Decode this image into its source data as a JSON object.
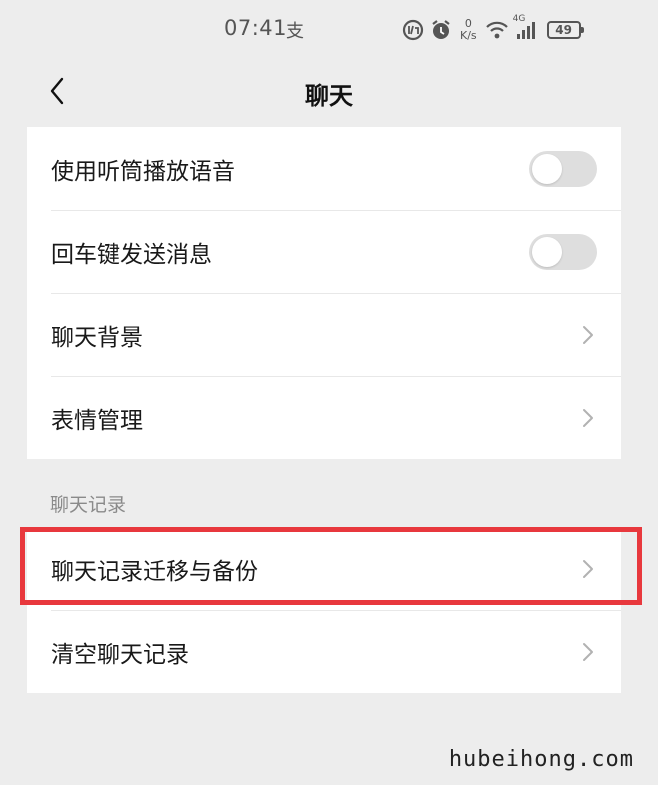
{
  "status_bar": {
    "time": "07:41",
    "pay_glyph": "支",
    "net_speed_value": "0",
    "net_speed_unit": "K/s",
    "network_type": "4G",
    "battery": "49"
  },
  "nav": {
    "title": "聊天"
  },
  "settings": [
    {
      "label": "使用听筒播放语音",
      "type": "toggle",
      "on": false
    },
    {
      "label": "回车键发送消息",
      "type": "toggle",
      "on": false
    },
    {
      "label": "聊天背景",
      "type": "link"
    },
    {
      "label": "表情管理",
      "type": "link"
    }
  ],
  "chat_history": {
    "section_title": "聊天记录",
    "items": [
      {
        "label": "聊天记录迁移与备份",
        "type": "link"
      },
      {
        "label": "清空聊天记录",
        "type": "link"
      }
    ]
  },
  "colors": {
    "background": "#ededed",
    "highlight": "#e8383d",
    "toggle_off": "#dedede"
  },
  "watermark": "hubeihong.com"
}
